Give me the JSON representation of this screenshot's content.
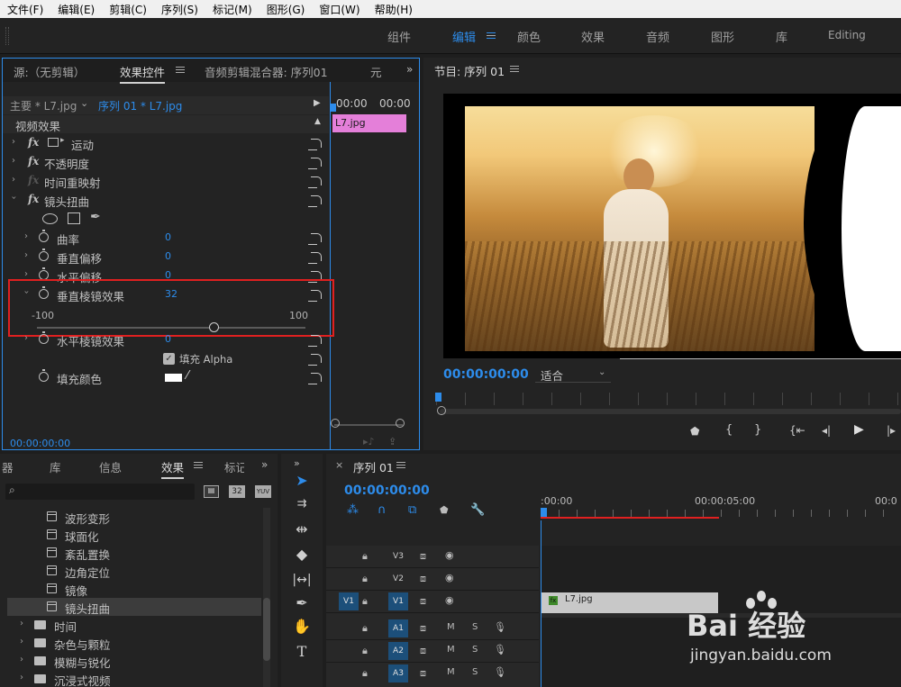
{
  "menubar": {
    "items": [
      "文件(F)",
      "编辑(E)",
      "剪辑(C)",
      "序列(S)",
      "标记(M)",
      "图形(G)",
      "窗口(W)",
      "帮助(H)"
    ]
  },
  "workspaces": {
    "tabs": [
      "组件",
      "编辑",
      "颜色",
      "效果",
      "音频",
      "图形",
      "库",
      "Editing"
    ],
    "active": "编辑"
  },
  "effect_controls": {
    "tabs": [
      "源:（无剪辑）",
      "效果控件",
      "音频剪辑混合器: 序列01",
      "元"
    ],
    "master_label": "主要 * L7.jpg",
    "sequence_label": "序列 01 * L7.jpg",
    "timecodes": [
      "00:00",
      "00:00"
    ],
    "clip_name": "L7.jpg",
    "video_effects_header": "视频效果",
    "effects": [
      {
        "name": "运动"
      },
      {
        "name": "不透明度"
      },
      {
        "name": "时间重映射"
      },
      {
        "name": "镜头扭曲"
      }
    ],
    "params": [
      {
        "name": "曲率",
        "value": "0"
      },
      {
        "name": "垂直偏移",
        "value": "0"
      },
      {
        "name": "水平偏移",
        "value": "0"
      },
      {
        "name": "垂直棱镜效果",
        "value": "32"
      },
      {
        "name": "水平棱镜效果",
        "value": "0"
      }
    ],
    "slider": {
      "min": "-100",
      "max": "100",
      "value": 32
    },
    "fill_alpha_label": "填充 Alpha",
    "fill_alpha_checked": true,
    "fill_color_label": "填充颜色",
    "fill_color": "#ffffff",
    "footer_timecode": "00:00:00:00"
  },
  "program": {
    "title": "节目: 序列 01",
    "timecode": "00:00:00:00",
    "fit_label": "适合"
  },
  "effects_panel": {
    "tabs": [
      "器",
      "库",
      "信息",
      "效果",
      "标记"
    ],
    "search_placeholder": "",
    "badges": [
      "32",
      "YUV"
    ],
    "items": [
      {
        "label": "波形变形",
        "type": "effect"
      },
      {
        "label": "球面化",
        "type": "effect"
      },
      {
        "label": "紊乱置换",
        "type": "effect"
      },
      {
        "label": "边角定位",
        "type": "effect"
      },
      {
        "label": "镜像",
        "type": "effect"
      },
      {
        "label": "镜头扭曲",
        "type": "effect",
        "selected": true
      },
      {
        "label": "时间",
        "type": "folder"
      },
      {
        "label": "杂色与颗粒",
        "type": "folder"
      },
      {
        "label": "模糊与锐化",
        "type": "folder"
      },
      {
        "label": "沉浸式视频",
        "type": "folder"
      }
    ]
  },
  "timeline": {
    "title": "序列 01",
    "timecode": "00:00:00:00",
    "ruler": [
      ":00:00",
      "00:00:05:00",
      "00:0"
    ],
    "video_tracks": [
      "V3",
      "V2",
      "V1"
    ],
    "audio_tracks": [
      "A1",
      "A2",
      "A3"
    ],
    "source_patch": [
      "V1",
      "A1"
    ],
    "clip_label": "L7.jpg",
    "ms_labels": [
      "M",
      "S"
    ]
  },
  "watermark": {
    "brand": "Bai 经验",
    "url": "jingyan.baidu.com"
  },
  "colors": {
    "accent": "#2d8ceb",
    "clip_pink": "#e47fd9",
    "highlight_red": "#e02020"
  }
}
